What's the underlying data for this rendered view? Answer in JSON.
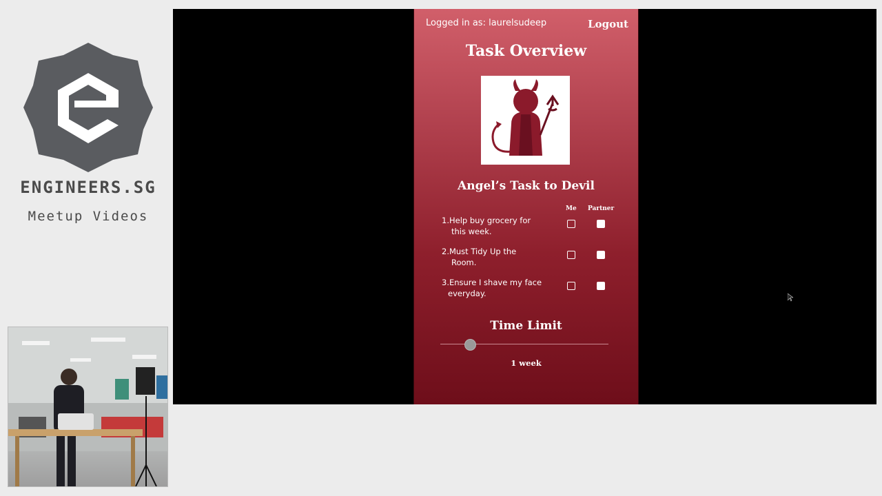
{
  "branding": {
    "name": "ENGINEERS.SG",
    "subtitle": "Meetup Videos",
    "colors": {
      "hex": "#5a5c60",
      "letter": "#ffffff"
    }
  },
  "app": {
    "header": {
      "logged_in_text": "Logged in as: laurelsudeep",
      "logout_label": "Logout"
    },
    "page_title": "Task Overview",
    "avatar": {
      "icon": "devil-icon"
    },
    "task_list": {
      "title": "Angel’s Task to Devil",
      "columns": {
        "me": "Me",
        "partner": "Partner"
      },
      "tasks": [
        {
          "line1": "1.Help buy grocery for",
          "line2": "this week.",
          "me_checked": false,
          "partner_checked": true
        },
        {
          "line1": "2.Must Tidy Up the",
          "line2": "Room.",
          "me_checked": false,
          "partner_checked": true
        },
        {
          "line1": "3.Ensure I shave my face",
          "line2": "everyday.",
          "me_checked": false,
          "partner_checked": true
        }
      ]
    },
    "time_limit": {
      "title": "Time Limit",
      "value_label": "1 week",
      "slider_fraction": 0.18
    },
    "colors": {
      "gradient_top": "#d15f6a",
      "gradient_bottom": "#6e0e1a",
      "devil": "#8b1a2b"
    }
  }
}
